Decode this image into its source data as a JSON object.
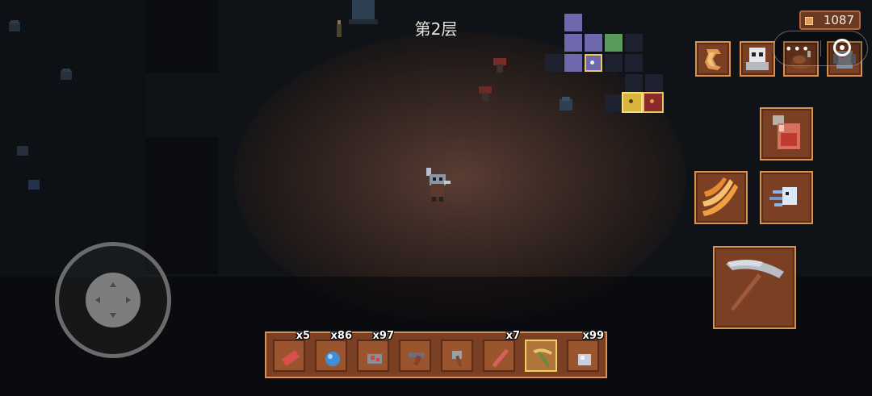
{
  "hud": {
    "floor_label": "第2层",
    "coins": "1087"
  },
  "minimap": {
    "rooms": [
      "visited",
      "visited",
      "visited",
      "unexplored",
      "current",
      "boss",
      "treasure"
    ]
  },
  "skills": [
    {
      "name": "boomerang-skill"
    },
    {
      "name": "ghost-skill"
    },
    {
      "name": "roast-chicken-skill"
    },
    {
      "name": "stone-golem-skill"
    }
  ],
  "actions": {
    "potion": "health-potion",
    "claw": "claw-attack",
    "dash": "dash",
    "mine": "pickaxe-mine"
  },
  "hotbar": {
    "slots": [
      {
        "item": "meat",
        "count": "x5"
      },
      {
        "item": "blue-gem",
        "count": "x86"
      },
      {
        "item": "red-ore",
        "count": "x97"
      },
      {
        "item": "revolver",
        "count": ""
      },
      {
        "item": "axe",
        "count": ""
      },
      {
        "item": "red-stick",
        "count": "x7"
      },
      {
        "item": "pickaxe",
        "count": "",
        "selected": true
      },
      {
        "item": "silver-ore",
        "count": "x99"
      }
    ]
  },
  "colors": {
    "tile_bg": "#7b3f24",
    "tile_border": "#d8914f",
    "minimap_visited": "#6e68ad",
    "minimap_highlight": "#e6c760"
  }
}
